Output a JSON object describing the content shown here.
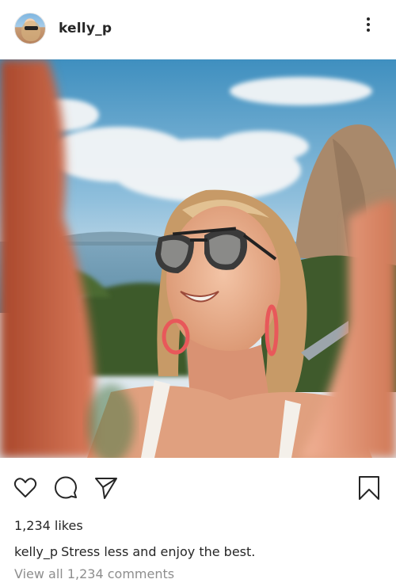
{
  "post": {
    "username": "kelly_p",
    "likes": "1,234 likes",
    "caption_user": "kelly_p",
    "caption_text": "Stress less and enjoy the best.",
    "view_comments": "View all 1,234 comments"
  },
  "icons": {
    "more": "more-vertical-icon",
    "like": "heart-icon",
    "comment": "comment-icon",
    "share": "send-icon",
    "save": "bookmark-icon"
  },
  "colors": {
    "text": "#262626",
    "muted": "#8e8e8e"
  }
}
